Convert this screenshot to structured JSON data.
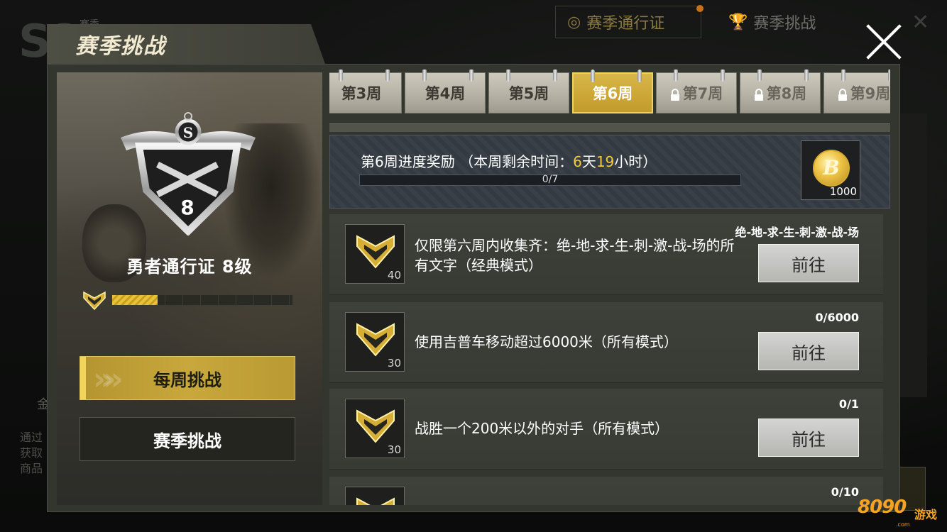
{
  "background": {
    "season_logo": "S8",
    "season_label": "赛季",
    "tab_pass": "赛季通行证",
    "tab_challenge": "赛季挑战",
    "side_gold": "金",
    "side_text": [
      "通过",
      "获取",
      "商品"
    ]
  },
  "dialog": {
    "title": "赛季挑战",
    "close_label": "关闭"
  },
  "pass": {
    "rank_number": "8",
    "title": "勇者通行证 8级",
    "progress": 0.25
  },
  "side_buttons": [
    {
      "label": "每周挑战",
      "active": true
    },
    {
      "label": "赛季挑战",
      "active": false
    }
  ],
  "weeks": [
    {
      "label": "第3周",
      "locked": false,
      "active": false
    },
    {
      "label": "第4周",
      "locked": false,
      "active": false
    },
    {
      "label": "第5周",
      "locked": false,
      "active": false
    },
    {
      "label": "第6周",
      "locked": false,
      "active": true
    },
    {
      "label": "第7周",
      "locked": true,
      "active": false
    },
    {
      "label": "第8周",
      "locked": true,
      "active": false
    },
    {
      "label": "第9周",
      "locked": true,
      "active": false
    }
  ],
  "reward": {
    "title_prefix": "第6周进度奖励 （本周剩余时间：",
    "days_num": "6",
    "days_unit": "天",
    "hours_num": "19",
    "hours_unit": "小时）",
    "progress_text": "0/7",
    "progress": 0,
    "coin_amount": "1000"
  },
  "tasks": [
    {
      "desc": "仅限第六周内收集齐：绝-地-求-生-刺-激-战-场的所有文字（经典模式）",
      "progress": "绝-地-求-生-刺-激-战-场",
      "points": "40",
      "button": "前往"
    },
    {
      "desc": "使用吉普车移动超过6000米（所有模式）",
      "progress": "0/6000",
      "points": "30",
      "button": "前往"
    },
    {
      "desc": "战胜一个200米以外的对手（所有模式）",
      "progress": "0/1",
      "points": "30",
      "button": "前往"
    },
    {
      "desc": "",
      "progress": "0/10",
      "points": "",
      "button": ""
    }
  ],
  "watermark": {
    "brand": "8090",
    "brand_cn": "游戏",
    "domain": ".com"
  },
  "colors": {
    "accent_gold": "#c8a83c",
    "highlight_yellow": "#f3c93a"
  }
}
